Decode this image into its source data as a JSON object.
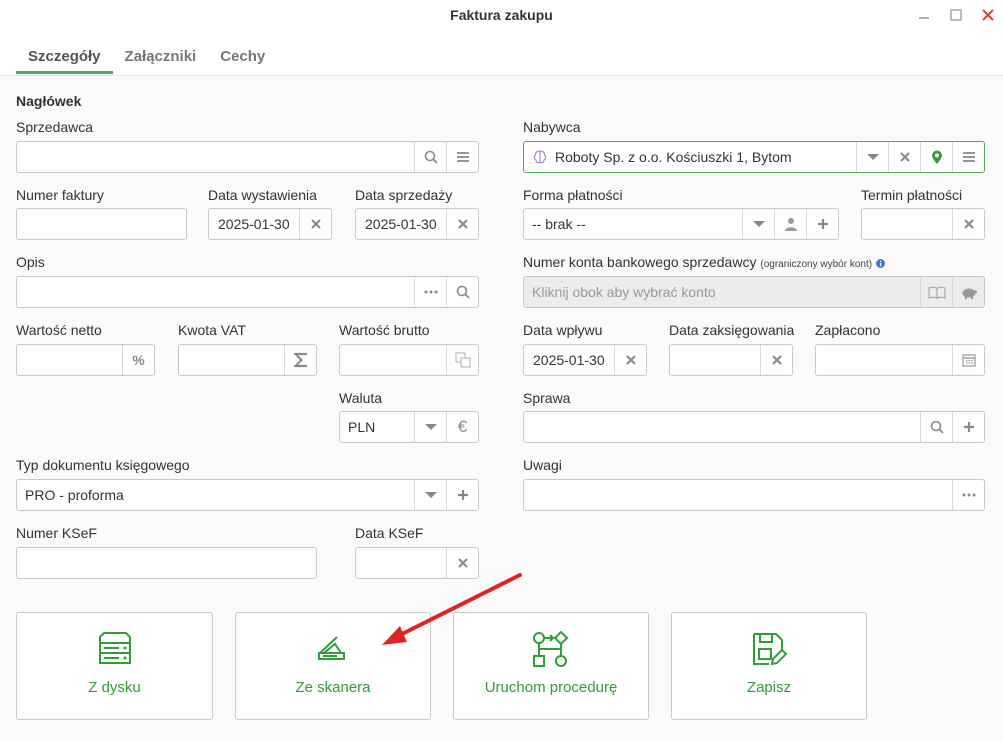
{
  "window": {
    "title": "Faktura zakupu"
  },
  "tabs": [
    "Szczegóły",
    "Załączniki",
    "Cechy"
  ],
  "section": "Nagłówek",
  "labels": {
    "seller": "Sprzedawca",
    "buyer": "Nabywca",
    "invoice_number": "Numer faktury",
    "issue_date": "Data wystawienia",
    "sale_date": "Data sprzedaży",
    "payment_form": "Forma płatności",
    "payment_due": "Termin płatności",
    "description": "Opis",
    "bank_account": "Numer konta bankowego sprzedawcy",
    "bank_account_note": "(ograniczony wybór kont)",
    "net": "Wartość netto",
    "vat": "Kwota VAT",
    "gross": "Wartość brutto",
    "receipt_date": "Data wpływu",
    "posting_date": "Data zaksięgowania",
    "paid": "Zapłacono",
    "currency": "Waluta",
    "case": "Sprawa",
    "doc_type": "Typ dokumentu księgowego",
    "notes": "Uwagi",
    "ksef_number": "Numer KSeF",
    "ksef_date": "Data KSeF"
  },
  "values": {
    "buyer": "Roboty Sp. z o.o. Kościuszki 1, Bytom",
    "issue_date": "2025-01-30",
    "sale_date": "2025-01-30",
    "payment_form": "-- brak --",
    "bank_account_placeholder": "Kliknij obok aby wybrać konto",
    "receipt_date": "2025-01-30",
    "currency": "PLN",
    "doc_type": "PRO - proforma",
    "percent_symbol": "%",
    "euro_symbol": "€"
  },
  "actions": {
    "from_disk": "Z dysku",
    "from_scanner": "Ze skanera",
    "run_procedure": "Uruchom procedurę",
    "save": "Zapisz"
  },
  "colors": {
    "accent": "#4caf50",
    "action_text": "#2e9e36",
    "close": "#e53935",
    "arrow": "#e02424"
  },
  "icons": [
    "search-icon",
    "menu-icon",
    "chevron-down-icon",
    "close-icon",
    "location-pin-icon",
    "person-icon",
    "plus-icon",
    "dots-icon",
    "book-icon",
    "piggy-bank-icon",
    "sigma-icon",
    "copy-icon",
    "calendar-icon",
    "info-icon",
    "server-icon",
    "scanner-icon",
    "workflow-icon",
    "save-icon"
  ]
}
